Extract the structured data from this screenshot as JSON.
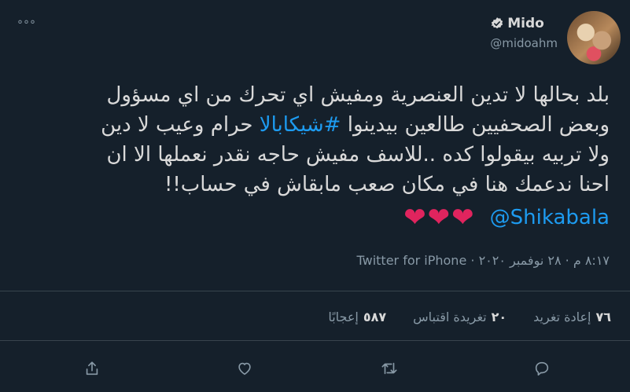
{
  "tweet": {
    "more_label": "°°°",
    "author_name": "Mido",
    "author_handle": "@midoahm",
    "text_lines": [
      "بلد بحالها  لا تدين العنصرية ومفيش اي تحرك من اي مسؤول",
      "وبعض الصحفيين طالعين بيدينوا",
      "ولا تربيه بيقولوا كده ..للاسف مفيش حاجه نقدر نعملها الا ان",
      "احنا ندعمك هنا في مكان صعب مابقاش في حساب!!"
    ],
    "hashtag": "#شيكابالا",
    "line2_tail": "حرام وعيب لا دين",
    "mention": "@Shikabala",
    "hearts": "❤❤❤",
    "meta": "٨:١٧ م · ٢٨ نوفمبر ٢٠٢٠ · Twitter for iPhone",
    "stats": {
      "retweets_count": "٧٦",
      "retweets_label": "إعادة تغريد",
      "quotes_count": "٢٠",
      "quotes_label": "تغريدة اقتباس",
      "likes_count": "٥٨٧",
      "likes_label": "إعجابًا"
    },
    "colors": {
      "background": "#15202b",
      "link": "#1d9bf0",
      "heart": "#e0245e",
      "muted": "#8899a6"
    },
    "icons": [
      "verified-badge-icon",
      "reply-icon",
      "retweet-icon",
      "like-icon",
      "share-icon"
    ]
  }
}
